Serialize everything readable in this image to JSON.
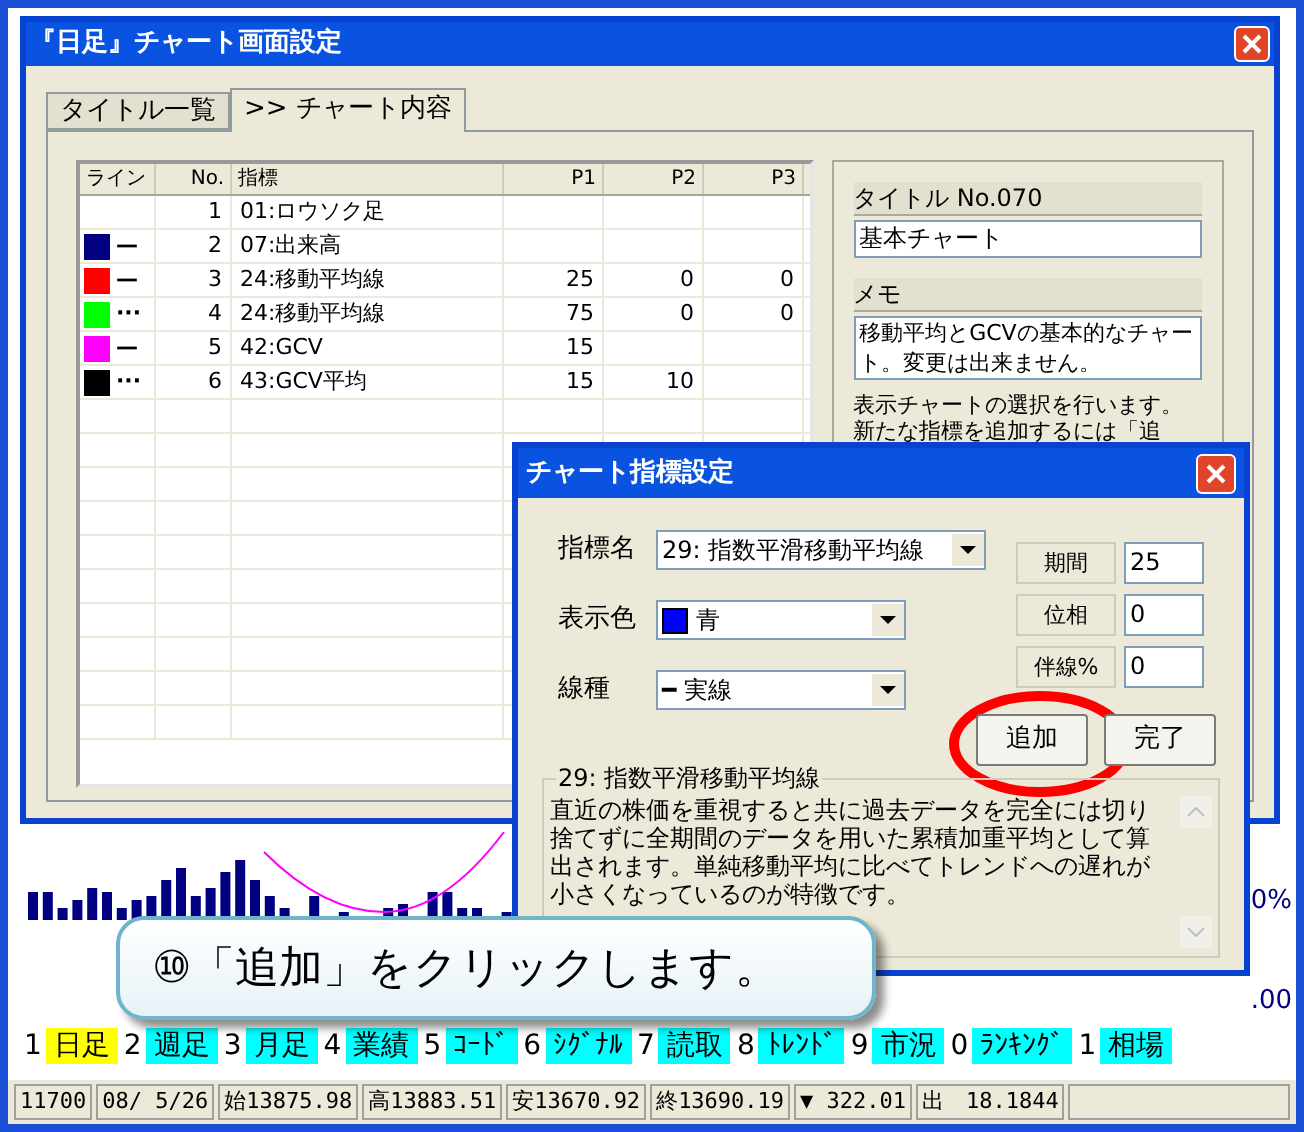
{
  "dialog": {
    "title": "『日足』チャート画面設定",
    "tabs": [
      {
        "label": "タイトル一覧",
        "selected": false
      },
      {
        "label": ">> チャート内容",
        "selected": true
      }
    ],
    "table": {
      "columns": [
        "ライン",
        "No.",
        "指標",
        "P1",
        "P2",
        "P3"
      ],
      "rows": [
        {
          "no": "1",
          "indicator": "01:ロウソク足",
          "p1": "",
          "p2": "",
          "p3": ""
        },
        {
          "color": "#000080",
          "line": "—",
          "no": "2",
          "indicator": "07:出来高",
          "p1": "",
          "p2": "",
          "p3": ""
        },
        {
          "color": "#ff0000",
          "line": "—",
          "no": "3",
          "indicator": "24:移動平均線",
          "p1": "25",
          "p2": "0",
          "p3": "0"
        },
        {
          "color": "#00ff00",
          "line": "···",
          "no": "4",
          "indicator": "24:移動平均線",
          "p1": "75",
          "p2": "0",
          "p3": "0"
        },
        {
          "color": "#ff00ff",
          "line": "—",
          "no": "5",
          "indicator": "42:GCV",
          "p1": "15",
          "p2": "",
          "p3": ""
        },
        {
          "color": "#000000",
          "line": "···",
          "no": "6",
          "indicator": "43:GCV平均",
          "p1": "15",
          "p2": "10",
          "p3": ""
        }
      ]
    },
    "title_label": "タイトル No.070",
    "title_value": "基本チャート",
    "memo_label": "メモ",
    "memo": "移動平均とGCVの基本的なチャート。変更は出来ません。",
    "help_lines": [
      "表示チャートの選択を行います。",
      "新たな指標を追加するには「追"
    ]
  },
  "sub_dialog": {
    "title": "チャート指標設定",
    "indicator_label": "指標名",
    "indicator_value": "29: 指数平滑移動平均線",
    "color_label": "表示色",
    "color_value": "青",
    "color": "#0000ff",
    "line_label": "線種",
    "line_value": "実線",
    "line_mark": "━",
    "params": [
      {
        "label": "期間",
        "value": "25"
      },
      {
        "label": "位相",
        "value": "0"
      },
      {
        "label": "伴線%",
        "value": "0"
      }
    ],
    "buttons": [
      {
        "label": "追加",
        "highlighted": true
      },
      {
        "label": "完了",
        "highlighted": false
      }
    ],
    "group_title": "29: 指数平滑移動平均線",
    "description": "直近の株価を重視すると共に過去データを完全には切り捨てずに全期間のデータを用いた累積加重平均として算出されます。単純移動平均に比べてトレンドへの遅れが小さくなっているのが特徴です。"
  },
  "callout": "⑩「追加」をクリックします。",
  "main_window": {
    "right_labels": [
      "0%",
      ".00"
    ],
    "function_keys": [
      {
        "number": "1",
        "label": "日足",
        "selected": true
      },
      {
        "number": "2",
        "label": "週足",
        "selected": false
      },
      {
        "number": "3",
        "label": "月足",
        "selected": false
      },
      {
        "number": "4",
        "label": "業績",
        "selected": false
      },
      {
        "number": "5",
        "label": "ｺｰﾄﾞ",
        "selected": false
      },
      {
        "number": "6",
        "label": "ｼｸﾞﾅﾙ",
        "selected": false
      },
      {
        "number": "7",
        "label": "読取",
        "selected": false
      },
      {
        "number": "8",
        "label": "ﾄﾚﾝﾄﾞ",
        "selected": false
      },
      {
        "number": "9",
        "label": "市況",
        "selected": false
      },
      {
        "number": "0",
        "label": "ﾗﾝｷﾝｸﾞ",
        "selected": false
      },
      {
        "number": "1",
        "label": "相場",
        "selected": false
      }
    ],
    "status_bar": [
      "11700",
      "08/ 5/26",
      "始13875.98",
      "高13883.51",
      "安13670.92",
      "終13690.19",
      "▼ 322.01",
      "出　18.1844"
    ]
  }
}
